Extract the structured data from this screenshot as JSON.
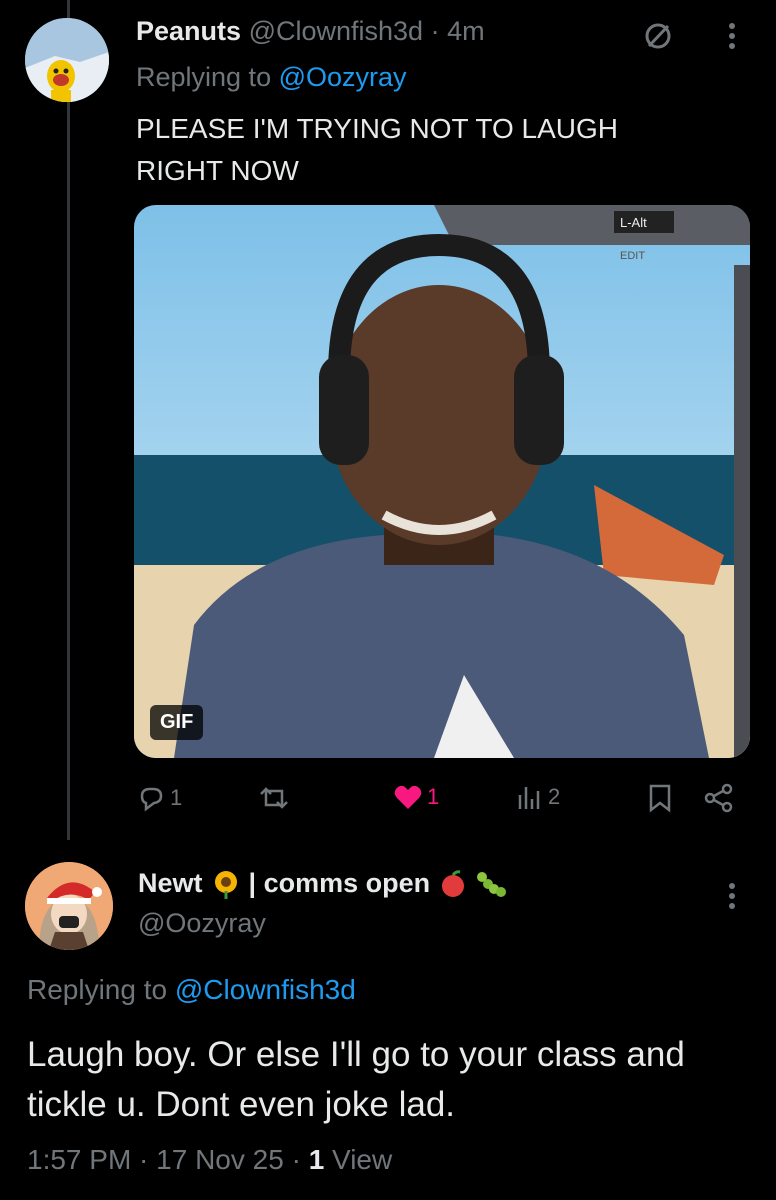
{
  "tweet1": {
    "display_name": "Peanuts",
    "handle": "@Clownfish3d",
    "separator": "·",
    "time": "4m",
    "replying_prefix": "Replying to ",
    "replying_handle": "@Oozyray",
    "body": "PLEASE I'M TRYING NOT TO LAUGH RIGHT NOW",
    "media_badge": "GIF",
    "media_overlay_text": "L-Alt",
    "media_overlay_text2": "EDIT",
    "actions": {
      "replies": "1",
      "reposts": "",
      "likes": "1",
      "views": "2"
    }
  },
  "tweet2": {
    "display_name": "Newt",
    "name_suffix": "| comms open",
    "handle": "@Oozyray",
    "replying_prefix": "Replying to ",
    "replying_handle": "@Clownfish3d",
    "body": "Laugh boy. Or else I'll go to your class and tickle u. Dont even joke lad.",
    "timestamp": "1:57 PM · 17 Nov 25 · ",
    "views_count": "1",
    "views_label": " View"
  },
  "colors": {
    "background": "#000000",
    "text": "#e7e9ea",
    "muted": "#71767b",
    "link": "#1d9bf0",
    "like": "#f91880"
  }
}
